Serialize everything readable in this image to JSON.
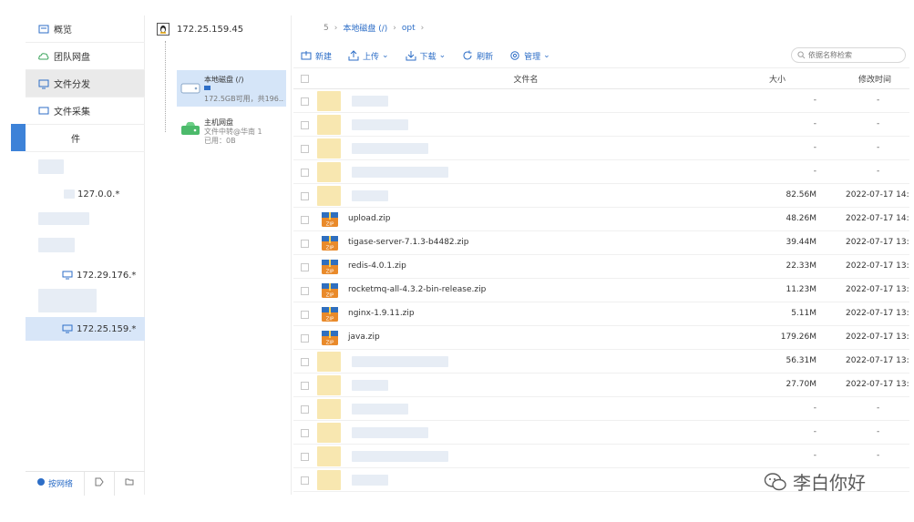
{
  "sidebar": {
    "nav": [
      {
        "label": "概览",
        "icon": "overview-icon"
      },
      {
        "label": "团队网盘",
        "icon": "cloud-icon"
      },
      {
        "label": "文件分发",
        "icon": "distribute-icon"
      },
      {
        "label": "文件采集",
        "icon": "collect-icon"
      },
      {
        "label": "件",
        "icon": "file-icon"
      }
    ],
    "hosts": [
      {
        "label": "127.0.0.*"
      },
      {
        "label": "172.29.176.*"
      },
      {
        "label": "172.25.159.*"
      }
    ],
    "bottom_tab_label": "按网络"
  },
  "mid": {
    "host_title": "172.25.159.45",
    "disk": {
      "name": "本地磁盘 (/)",
      "meta": "172.5GB可用，共196...",
      "used_fraction": 0.12
    },
    "host_disk": {
      "name": "主机网盘",
      "sub": "文件中转@华南 1",
      "used": "已用：0B"
    }
  },
  "breadcrumb": {
    "prefix": "5",
    "items": [
      "本地磁盘 (/)",
      "opt"
    ]
  },
  "toolbar": {
    "new_label": "新建",
    "upload_label": "上传",
    "download_label": "下载",
    "refresh_label": "刷新",
    "manage_label": "管理",
    "search_placeholder": "依据名称检索"
  },
  "table": {
    "headers": {
      "name": "文件名",
      "size": "大小",
      "time": "修改时间"
    },
    "rows": [
      {
        "name": "",
        "size": "-",
        "time": "-",
        "blurred": true
      },
      {
        "name": "",
        "size": "-",
        "time": "-",
        "blurred": true
      },
      {
        "name": "",
        "size": "-",
        "time": "-",
        "blurred": true
      },
      {
        "name": "",
        "size": "-",
        "time": "-",
        "blurred": true
      },
      {
        "name": "",
        "size": "82.56M",
        "time": "2022-07-17 14:",
        "blurred": true
      },
      {
        "name": "upload.zip",
        "size": "48.26M",
        "time": "2022-07-17 14:",
        "blurred": false
      },
      {
        "name": "tigase-server-7.1.3-b4482.zip",
        "size": "39.44M",
        "time": "2022-07-17 13:",
        "blurred": false
      },
      {
        "name": "redis-4.0.1.zip",
        "size": "22.33M",
        "time": "2022-07-17 13:",
        "blurred": false
      },
      {
        "name": "rocketmq-all-4.3.2-bin-release.zip",
        "size": "11.23M",
        "time": "2022-07-17 13:",
        "blurred": false
      },
      {
        "name": "nginx-1.9.11.zip",
        "size": "5.11M",
        "time": "2022-07-17 13:",
        "blurred": false
      },
      {
        "name": "java.zip",
        "size": "179.26M",
        "time": "2022-07-17 13:",
        "blurred": false
      },
      {
        "name": "",
        "size": "56.31M",
        "time": "2022-07-17 13:",
        "blurred": true
      },
      {
        "name": "",
        "size": "27.70M",
        "time": "2022-07-17 13:",
        "blurred": true
      },
      {
        "name": "",
        "size": "-",
        "time": "-",
        "blurred": true
      },
      {
        "name": "",
        "size": "-",
        "time": "-",
        "blurred": true
      },
      {
        "name": "",
        "size": "-",
        "time": "-",
        "blurred": true
      },
      {
        "name": "",
        "size": "",
        "time": "",
        "blurred": true
      }
    ]
  },
  "watermark": {
    "text": "李白你好"
  },
  "colors": {
    "accent": "#2d6ec7",
    "selected": "#d8e6f8",
    "zip_orange": "#e98a2a"
  }
}
